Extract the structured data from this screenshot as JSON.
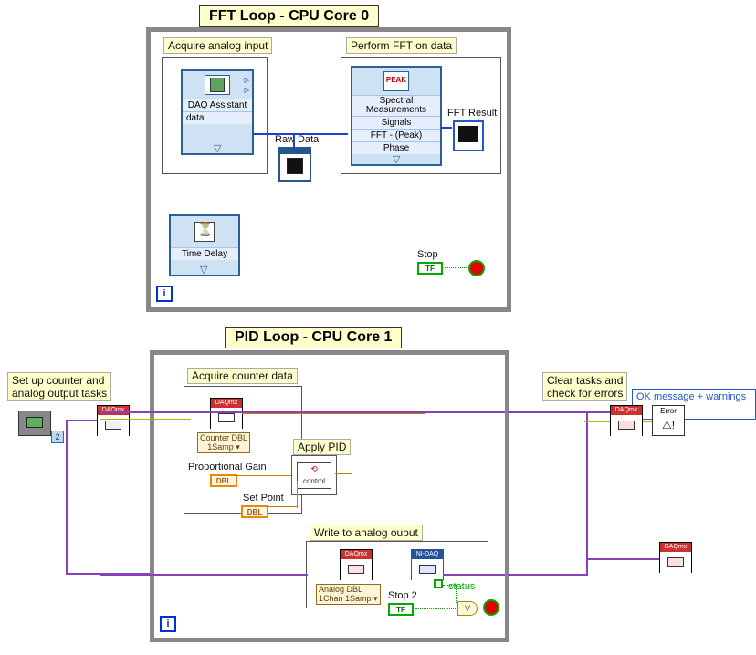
{
  "top": {
    "title": "FFT Loop - CPU Core 0",
    "acquire_label": "Acquire analog input",
    "perform_label": "Perform FFT on data",
    "daq": {
      "name": "DAQ Assistant",
      "out1": "data"
    },
    "raw_data_label": "Raw Data",
    "spectral": {
      "name": "Spectral",
      "name2": "Measurements",
      "row1": "Signals",
      "row2": "FFT - (Peak)",
      "row3": "Phase"
    },
    "fft_result_label": "FFT Result",
    "time_delay_label": "Time Delay",
    "stop_label": "Stop",
    "tf_label": "TF",
    "i_label": "i"
  },
  "bottom": {
    "title": "PID Loop - CPU Core 1",
    "setup_label": "Set up counter and\nanalog output tasks",
    "acquire_label": "Acquire counter data",
    "clear_label": "Clear tasks and\ncheck for errors",
    "dropdown": "OK message + warnings",
    "poly1": "Counter DBL\n1Samp",
    "prop_gain_label": "Proportional Gain",
    "setpoint_label": "Set Point",
    "apply_pid_label": "Apply PID",
    "pid_top": "⟲",
    "pid_text": "control",
    "write_label": "Write to analog ouput",
    "poly2": "Analog DBL\n1Chan 1Samp",
    "nidaq_band": "NI-DAQ",
    "daqmx_band": "DAQmx",
    "stop2_label": "Stop 2",
    "status_label": "status",
    "or_label": "V",
    "dbl_label": "DBL",
    "tf_label": "TF",
    "i_label": "i",
    "const2": "2",
    "error_text": "Error"
  }
}
